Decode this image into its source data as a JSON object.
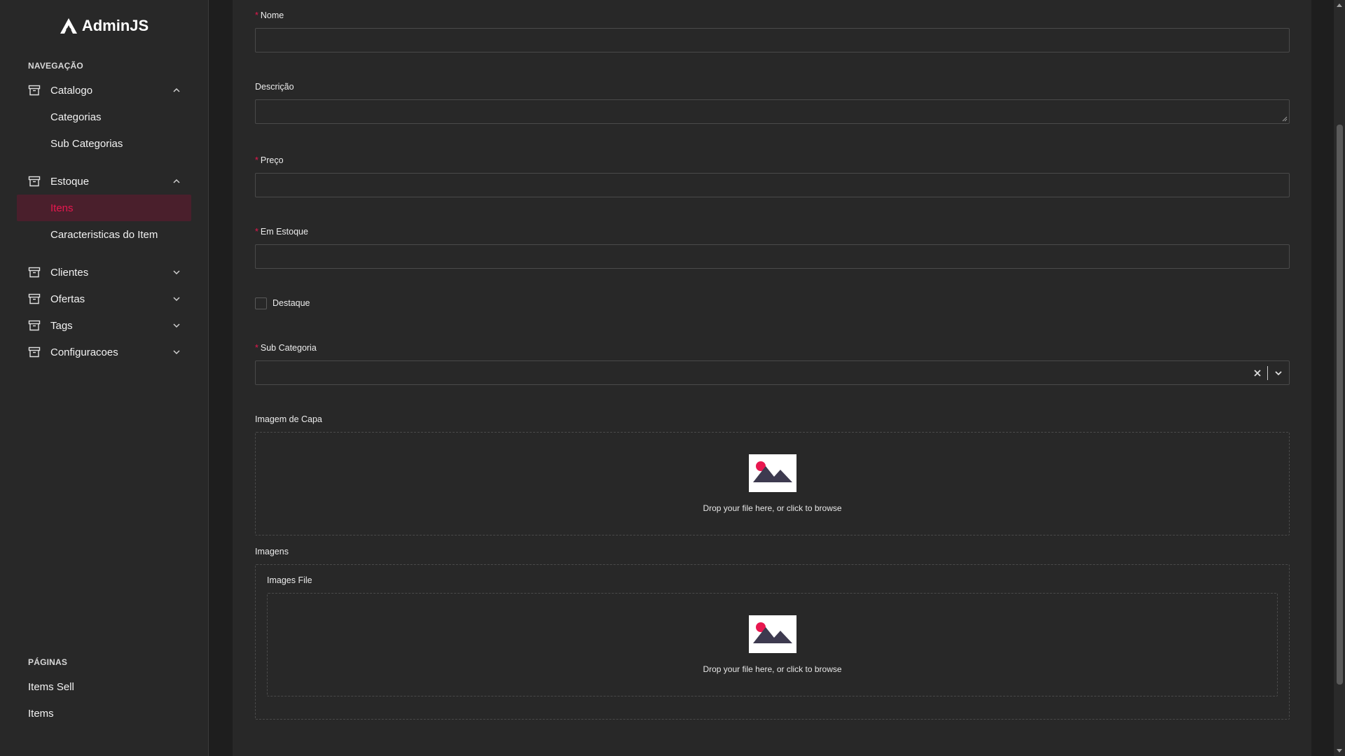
{
  "app": {
    "logo_text": "AdminJS"
  },
  "sidebar": {
    "navigation_label": "NAVEGAÇÃO",
    "groups": [
      {
        "label": "Catalogo",
        "expanded": true,
        "icon": "archive-icon",
        "items": [
          {
            "label": "Categorias"
          },
          {
            "label": "Sub Categorias"
          }
        ]
      },
      {
        "label": "Estoque",
        "expanded": true,
        "icon": "archive-icon",
        "items": [
          {
            "label": "Itens",
            "active": true
          },
          {
            "label": "Caracteristicas do Item"
          }
        ]
      },
      {
        "label": "Clientes",
        "expanded": false,
        "icon": "archive-icon"
      },
      {
        "label": "Ofertas",
        "expanded": false,
        "icon": "archive-icon"
      },
      {
        "label": "Tags",
        "expanded": false,
        "icon": "archive-icon"
      },
      {
        "label": "Configuracoes",
        "expanded": false,
        "icon": "archive-icon"
      }
    ],
    "pages_label": "PÁGINAS",
    "pages": [
      {
        "label": "Items Sell"
      },
      {
        "label": "Items"
      }
    ]
  },
  "form": {
    "nome": {
      "label": "Nome",
      "required": true,
      "value": ""
    },
    "descricao": {
      "label": "Descrição",
      "required": false,
      "value": ""
    },
    "preco": {
      "label": "Preço",
      "required": true,
      "value": ""
    },
    "em_estoque": {
      "label": "Em Estoque",
      "required": true,
      "value": ""
    },
    "destaque": {
      "label": "Destaque",
      "checked": false
    },
    "sub_categoria": {
      "label": "Sub Categoria",
      "required": true,
      "value": ""
    },
    "imagem_capa": {
      "label": "Imagem de Capa",
      "dropzone_text": "Drop your file here, or click to browse"
    },
    "imagens": {
      "label": "Imagens",
      "sub_label": "Images File",
      "dropzone_text": "Drop your file here, or click to browse"
    }
  },
  "colors": {
    "accent": "#e8174f",
    "background": "#1e1e1e",
    "panel": "#282828",
    "active_bg": "#4a1f2c"
  }
}
